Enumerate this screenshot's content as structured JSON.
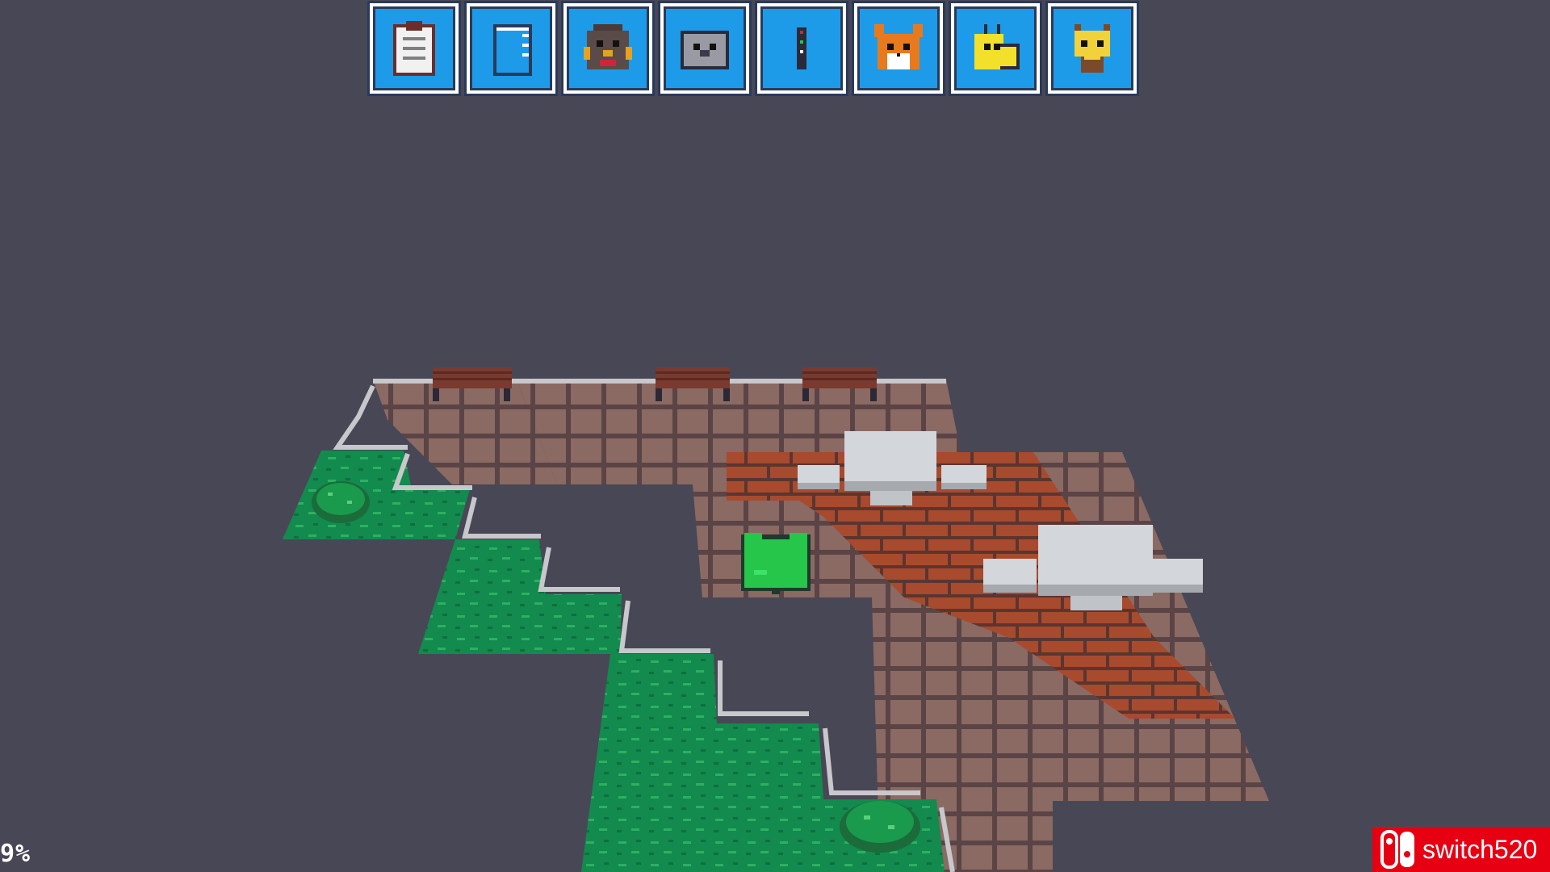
{
  "toolbar": {
    "items": [
      {
        "icon": "clipboard-icon"
      },
      {
        "icon": "notebook-icon"
      },
      {
        "icon": "brown-bird-character-icon"
      },
      {
        "icon": "koala-character-icon"
      },
      {
        "icon": "remote-control-icon"
      },
      {
        "icon": "orange-fox-character-icon"
      },
      {
        "icon": "yellow-bird-character-icon"
      },
      {
        "icon": "giraffe-character-icon"
      }
    ]
  },
  "hud": {
    "progress": "9%"
  },
  "watermark": {
    "text": "switch520",
    "color": "#e60012"
  },
  "colors": {
    "background": "#484756",
    "slot_fill": "#1e9be8",
    "floor_tile": "#8a6a63",
    "grout": "#5b4446",
    "brick": "#a84a2e",
    "grass": "#138a4e",
    "player": "#25c64a",
    "table": "#d3d6da"
  }
}
